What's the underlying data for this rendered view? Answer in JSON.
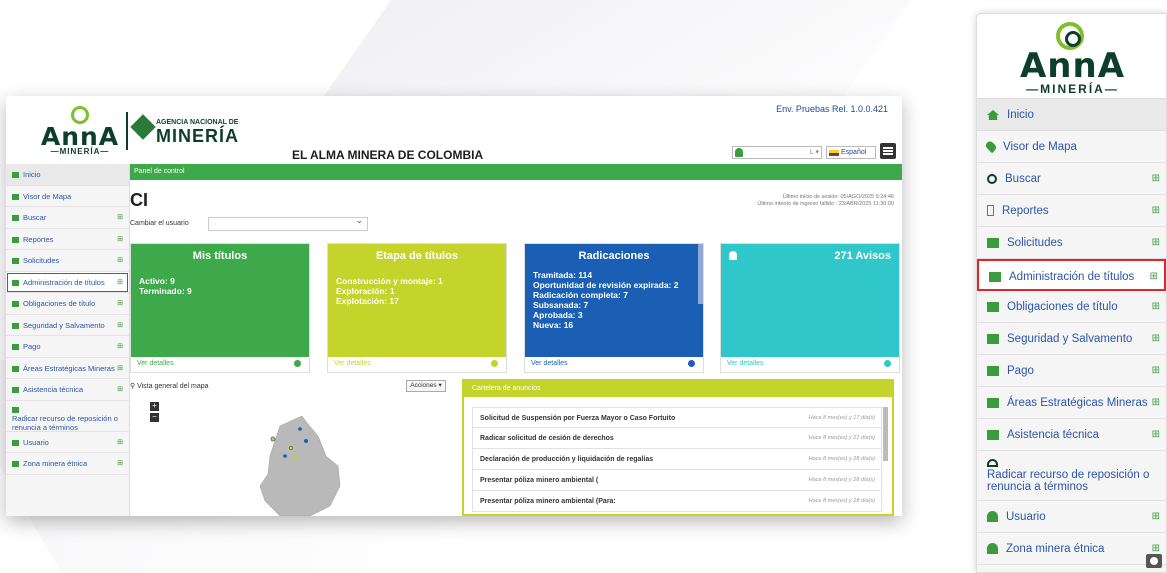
{
  "env": "Env. Pruebas Rel. 1.0.0.421",
  "logo": {
    "word": "AnnA",
    "sub": "—MINERÍA—"
  },
  "agencia": {
    "small": "AGENCIA NACIONAL DE",
    "big": "MINERÍA"
  },
  "site_title": "EL ALMA MINERA DE COLOMBIA",
  "header": {
    "user_placeholder": "",
    "user_dropdown": "L ▾",
    "language": "Español"
  },
  "breadcrumb": "Panel de control",
  "page_title": "CI",
  "last_session": {
    "line1": "Último inicio de sesión: 05/AGO/2025 9:24:46",
    "line2": "Último intento de ingreso fallido : 23/ABR/2025 11:30:00"
  },
  "change_user_label": "Cambiar el usuario",
  "sidebar": {
    "items": [
      {
        "label": "Inicio",
        "plus": ""
      },
      {
        "label": "Visor de Mapa",
        "plus": ""
      },
      {
        "label": "Buscar",
        "plus": "⊞"
      },
      {
        "label": "Reportes",
        "plus": "⊞"
      },
      {
        "label": "Solicitudes",
        "plus": "⊞"
      },
      {
        "label": "Administración de títulos",
        "plus": "⊞"
      },
      {
        "label": "Obligaciones de título",
        "plus": "⊞"
      },
      {
        "label": "Seguridad y Salvamento",
        "plus": "⊞"
      },
      {
        "label": "Pago",
        "plus": "⊞"
      },
      {
        "label": "Áreas Estratégicas Mineras",
        "plus": "⊞"
      },
      {
        "label": "Asistencia técnica",
        "plus": "⊞"
      },
      {
        "label": "Radicar recurso de reposición o renuncia a términos",
        "plus": ""
      },
      {
        "label": "Usuario",
        "plus": "⊞"
      },
      {
        "label": "Zona minera étnica",
        "plus": "⊞"
      }
    ]
  },
  "cards": {
    "mis_titulos": {
      "title": "Mis títulos",
      "lines": [
        "Activo: 9",
        "Terminado: 9"
      ],
      "footer": "Ver detalles"
    },
    "etapa": {
      "title": "Etapa de títulos",
      "lines": [
        "Construcción y montaje: 1",
        "Exploración: 1",
        "Explotación: 17"
      ],
      "footer": "Ver detalles"
    },
    "radicaciones": {
      "title": "Radicaciones",
      "lines": [
        "Tramitada: 114",
        "Oportunidad de revisión expirada: 2",
        "Radicación completa: 7",
        "Subsanada: 7",
        "Aprobada: 3",
        "Nueva: 16"
      ],
      "footer": "Ver detalles"
    },
    "avisos": {
      "title": "271 Avisos",
      "footer": "Ver detalles"
    }
  },
  "map": {
    "label": "Vista general del mapa",
    "actions": "Acciones ▾",
    "zoom_in": "+",
    "zoom_out": "−"
  },
  "announcements": {
    "header": "Cartelera de anuncios",
    "rows": [
      {
        "text": "Solicitud de Suspensión por Fuerza Mayor o Caso Fortuito",
        "when": "Hace 8 mes(es) y 17 día(s)"
      },
      {
        "text": "Radicar solicitud de cesión de derechos",
        "when": "Hace 8 mes(es) y 21 día(s)"
      },
      {
        "text": "Declaración de producción y liquidación de regalías",
        "when": "Hace 8 mes(es) y 28 día(s)"
      },
      {
        "text": "Presentar póliza minero ambiental (",
        "when": "Hace 8 mes(es) y 28 día(s)"
      },
      {
        "text": "Presentar póliza minero ambiental (Para:",
        "when": "Hace 8 mes(es) y 28 día(s)"
      }
    ]
  }
}
